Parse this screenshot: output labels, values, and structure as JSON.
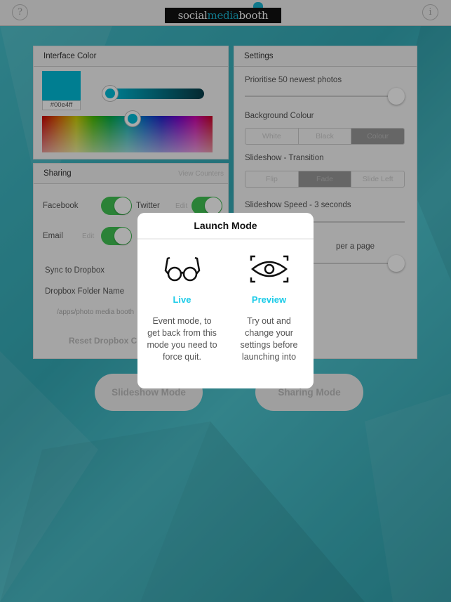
{
  "header": {
    "help_icon": "question-mark",
    "info_icon": "info",
    "logo": {
      "part1": "social",
      "part2": "media",
      "part3": "booth"
    }
  },
  "interface_color": {
    "title": "Interface Color",
    "hex": "#00e4ff",
    "swatch_color": "#00bcd8"
  },
  "settings": {
    "title": "Settings",
    "prioritise_label": "Prioritise 50 newest photos",
    "prioritise_value": 1.0,
    "background_label": "Background Colour",
    "background_options": [
      "White",
      "Black",
      "Colour"
    ],
    "background_selected": "Colour",
    "transition_label": "Slideshow - Transition",
    "transition_options": [
      "Flip",
      "Fade",
      "Slide Left"
    ],
    "transition_selected": "Fade",
    "speed_label": "Slideshow Speed - 3 seconds",
    "per_page_label": "per a page"
  },
  "sharing": {
    "title": "Sharing",
    "view_counters": "View Counters",
    "facebook": "Facebook",
    "twitter": "Twitter",
    "email": "Email",
    "edit": "Edit",
    "sync_dropbox": "Sync to Dropbox",
    "folder_label": "Dropbox Folder Name",
    "folder_value": "/apps/photo media booth",
    "reset": "Reset Dropbox C"
  },
  "buttons": {
    "slideshow": "Slideshow Mode",
    "sharing": "Sharing Mode"
  },
  "modal": {
    "title": "Launch Mode",
    "live": {
      "label": "Live",
      "icon": "glasses",
      "description": "Event mode, to get back from this mode you need to force quit."
    },
    "preview": {
      "label": "Preview",
      "icon": "eye",
      "description": "Try out and change your settings before launching into"
    }
  },
  "colors": {
    "accent": "#1ccbe8",
    "toggle": "#41c253"
  }
}
